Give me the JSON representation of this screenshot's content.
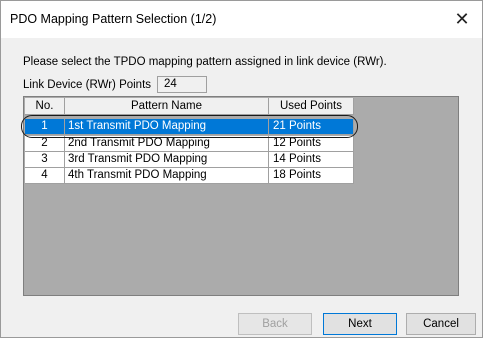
{
  "dialog": {
    "title": "PDO Mapping Pattern Selection (1/2)",
    "close_glyph": "✕"
  },
  "prompt": "Please select the TPDO mapping pattern assigned in link device (RWr).",
  "link_points": {
    "label": "Link Device (RWr) Points",
    "value": "24"
  },
  "table": {
    "columns": [
      "No.",
      "Pattern Name",
      "Used Points"
    ],
    "rows": [
      {
        "no": "1",
        "name": "1st Transmit PDO Mapping",
        "points": "21 Points",
        "selected": true
      },
      {
        "no": "2",
        "name": "2nd Transmit PDO Mapping",
        "points": "12 Points",
        "selected": false
      },
      {
        "no": "3",
        "name": "3rd Transmit PDO Mapping",
        "points": "14 Points",
        "selected": false
      },
      {
        "no": "4",
        "name": "4th Transmit PDO Mapping",
        "points": "18 Points",
        "selected": false
      }
    ]
  },
  "buttons": {
    "back": "Back",
    "next": "Next",
    "cancel": "Cancel"
  },
  "colors": {
    "selection": "#0078d7",
    "grid_background": "#ababab",
    "dialog_background": "#f0f0f0"
  }
}
